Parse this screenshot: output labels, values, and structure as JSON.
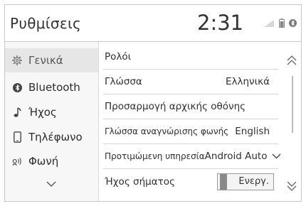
{
  "header": {
    "title": "Ρυθμίσεις",
    "time": "2:31"
  },
  "sidebar": {
    "items": [
      {
        "label": "Γενικά",
        "icon": "gear-icon",
        "active": true
      },
      {
        "label": "Bluetooth",
        "icon": "bluetooth-icon"
      },
      {
        "label": "Ήχος",
        "icon": "music-note-icon"
      },
      {
        "label": "Τηλέφωνο",
        "icon": "phone-icon"
      },
      {
        "label": "Φωνή",
        "icon": "voice-icon"
      }
    ]
  },
  "settings": [
    {
      "label": "Ρολόι",
      "value": ""
    },
    {
      "label": "Γλώσσα",
      "value": "Ελληνικά"
    },
    {
      "label": "Προσαρμογή αρχικής οθόνης",
      "value": ""
    },
    {
      "label": "Γλώσσα αναγνώρισης φωνής",
      "value": "English"
    },
    {
      "label": "Προτιμώμενη υπηρεσία",
      "value": "Android Auto"
    },
    {
      "label": "Ήχος σήματος",
      "value": "Ενεργ."
    }
  ]
}
